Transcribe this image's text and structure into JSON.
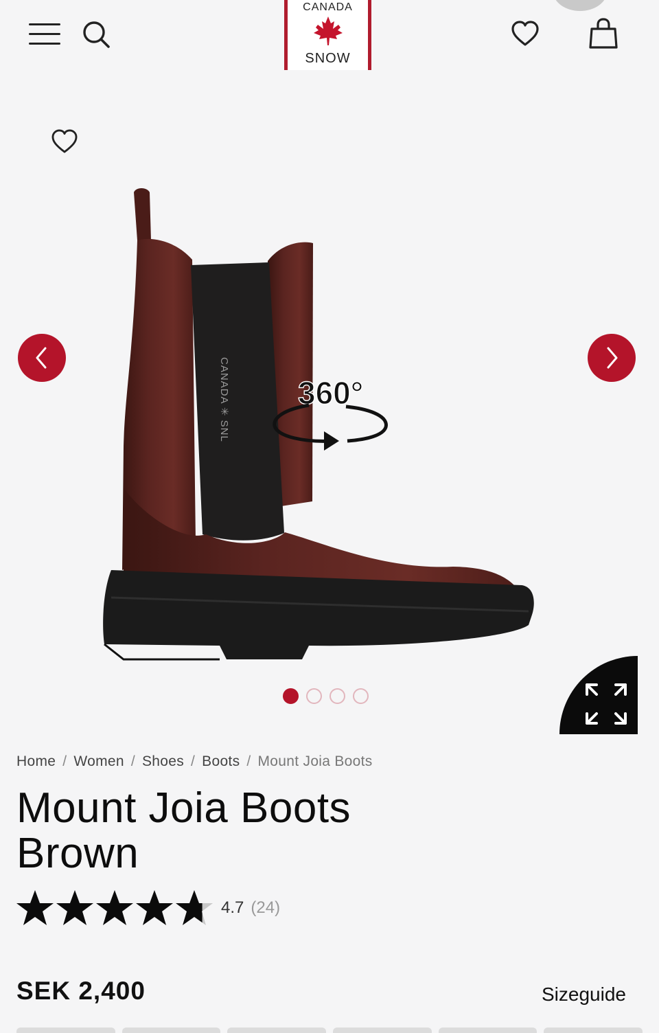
{
  "header": {
    "logo_top": "CANADA",
    "logo_bottom": "SNOW",
    "brand_color": "#b01c2e",
    "icons": [
      "menu-icon",
      "search-icon",
      "heart-icon",
      "shopping-bag-icon"
    ]
  },
  "gallery": {
    "badge": "360°",
    "slide_count": 4,
    "active_slide": 1,
    "accent": "#b4142a"
  },
  "breadcrumb": {
    "items": [
      "Home",
      "Women",
      "Shoes",
      "Boots",
      "Mount Joia Boots"
    ],
    "separator": "/"
  },
  "product": {
    "title_line1": "Mount Joia Boots",
    "title_line2": "Brown",
    "rating_value": "4.7",
    "rating_count": "(24)",
    "rating_numeric": 4.7,
    "price": "SEK 2,400",
    "sizeguide_label": "Sizeguide"
  }
}
